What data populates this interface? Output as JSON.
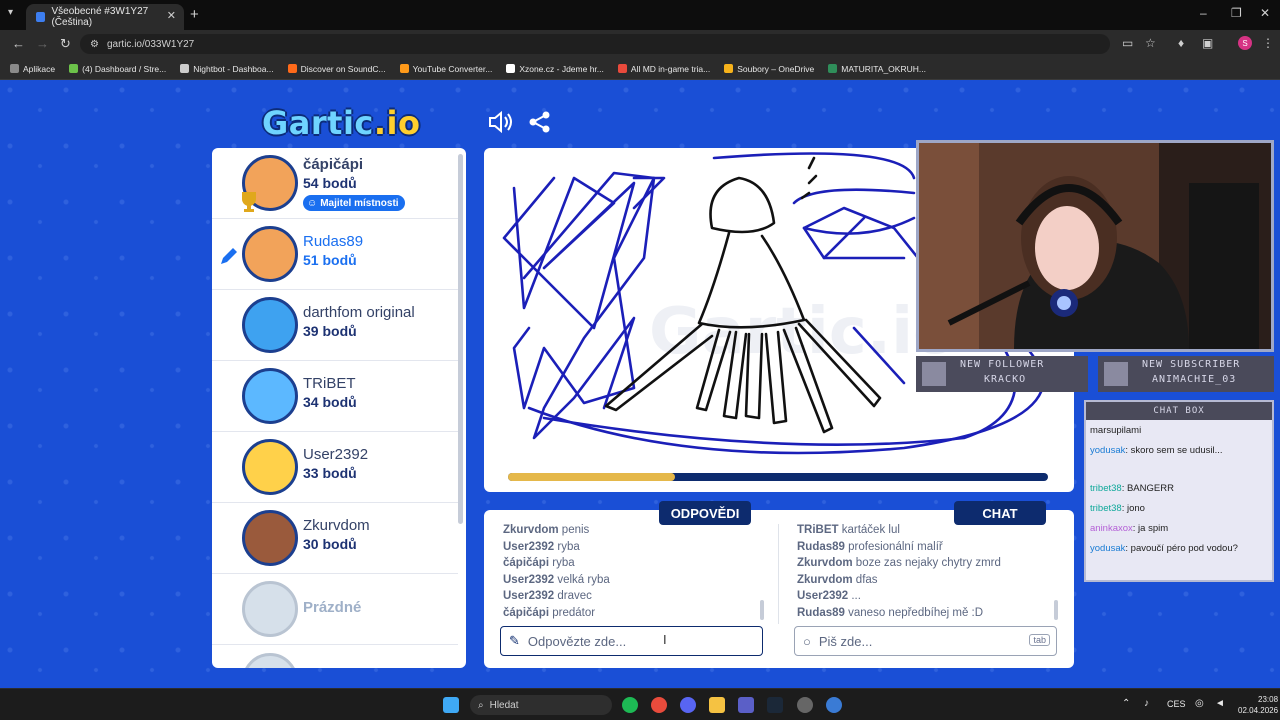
{
  "browser": {
    "tab_title": "Všeobecné #3W1Y27 (Čeština)",
    "new_tab": "+",
    "url": "gartic.io/033W1Y27",
    "bookmarks": [
      {
        "label": "Aplikace",
        "color": "#8a8a8a"
      },
      {
        "label": "(4) Dashboard / Stre...",
        "color": "#6cc24a"
      },
      {
        "label": "Nightbot - Dashboa...",
        "color": "#cccccc"
      },
      {
        "label": "Discover on SoundC...",
        "color": "#ff6a1a"
      },
      {
        "label": "YouTube Converter...",
        "color": "#ff9a1a"
      },
      {
        "label": "Xzone.cz - Jdeme hr...",
        "color": "#ffffff"
      },
      {
        "label": "All MD in-game tria...",
        "color": "#e94a3c"
      },
      {
        "label": "Soubory – OneDrive",
        "color": "#f6b21b"
      },
      {
        "label": "MATURITA_OKRUH...",
        "color": "#2f8e5a"
      }
    ]
  },
  "game": {
    "logo_main": "Gartic",
    "logo_suffix": ".io",
    "players": [
      {
        "name": "čápičápi",
        "score": "54 bodů",
        "badge": "Majitel místnosti",
        "color": "#f2a35a"
      },
      {
        "name": "Rudas89",
        "score": "51 bodů",
        "color": "#f2a35a"
      },
      {
        "name": "darthfom original",
        "score": "39 bodů",
        "color": "#3ea2f0"
      },
      {
        "name": "TRiBET",
        "score": "34 bodů",
        "color": "#5cb8ff"
      },
      {
        "name": "User2392",
        "score": "33 bodů",
        "color": "#ffd14a"
      },
      {
        "name": "Zkurvdom",
        "score": "30 bodů",
        "color": "#9a5a3c"
      }
    ],
    "empty_slot": "Prázdné",
    "round_progress": 0.31,
    "answers_header": "ODPOVĚDI",
    "chat_header": "CHAT",
    "answers": [
      {
        "user": "Zkurvdom",
        "text": "penis"
      },
      {
        "user": "User2392",
        "text": "ryba"
      },
      {
        "user": "čápičápi",
        "text": "ryba"
      },
      {
        "user": "User2392",
        "text": "velká ryba"
      },
      {
        "user": "User2392",
        "text": "dravec"
      },
      {
        "user": "čápičápi",
        "text": "predátor"
      }
    ],
    "chat": [
      {
        "user": "TRiBET",
        "text": "kartáček lul"
      },
      {
        "user": "Rudas89",
        "text": "profesionální malíř"
      },
      {
        "user": "Zkurvdom",
        "text": "boze zas nejaky chytry zmrd"
      },
      {
        "user": "Zkurvdom",
        "text": "dfas"
      },
      {
        "user": "User2392",
        "text": "..."
      },
      {
        "user": "Rudas89",
        "text": "vaneso nepředbíhej mě :D"
      }
    ],
    "answer_placeholder": "Odpovězte zde...",
    "chat_placeholder": "Piš zde...",
    "tab_hint": "tab"
  },
  "stream": {
    "new_follower_label": "NEW FOLLOWER",
    "new_follower_name": "KRACKO",
    "new_subscriber_label": "NEW SUBSCRIBER",
    "new_subscriber_name": "ANIMACHIE_03",
    "chatbox_title": "CHAT BOX",
    "chat": [
      {
        "user": "",
        "text": "marsupilami"
      },
      {
        "user": "yodusak",
        "text": ": skoro sem se udusil..."
      },
      {
        "user": "tribet38",
        "text": ": BANGERR"
      },
      {
        "user": "tribet38",
        "text": ": jono"
      },
      {
        "user": "aninkaxox",
        "text": ": ja spim"
      },
      {
        "user": "yodusak",
        "text": ": pavoučí péro pod vodou?"
      }
    ]
  },
  "taskbar": {
    "search": "Hledat",
    "lang": "CES",
    "time": "23:08",
    "date": "02.04.2026"
  }
}
